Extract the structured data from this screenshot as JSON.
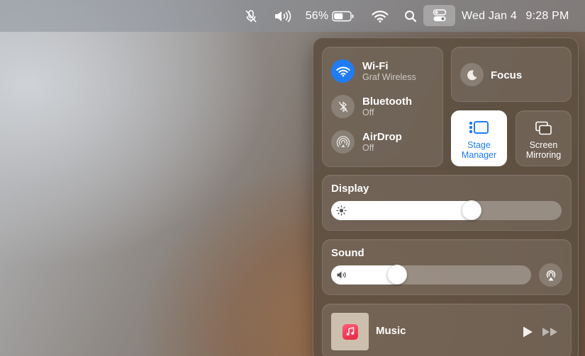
{
  "menubar": {
    "battery_percent": "56%",
    "battery_level": 0.56,
    "date": "Wed Jan 4",
    "time": "9:28 PM",
    "icons": [
      "microphone-muted-icon",
      "volume-icon",
      "battery-icon",
      "wifi-icon",
      "search-icon",
      "control-center-icon"
    ]
  },
  "control_center": {
    "network": {
      "wifi": {
        "title": "Wi-Fi",
        "subtitle": "Graf Wireless",
        "active": true
      },
      "bluetooth": {
        "title": "Bluetooth",
        "subtitle": "Off",
        "active": false
      },
      "airdrop": {
        "title": "AirDrop",
        "subtitle": "Off",
        "active": false
      }
    },
    "focus": {
      "label": "Focus"
    },
    "stage_manager": {
      "label_line1": "Stage",
      "label_line2": "Manager",
      "active": true
    },
    "screen_mirroring": {
      "label_line1": "Screen",
      "label_line2": "Mirroring"
    },
    "display": {
      "title": "Display",
      "brightness": 0.61
    },
    "sound": {
      "title": "Sound",
      "volume": 0.33
    },
    "music": {
      "label": "Music"
    }
  },
  "colors": {
    "accent": "#1f7cf5",
    "stage_manager_text": "#1f7cf5"
  }
}
